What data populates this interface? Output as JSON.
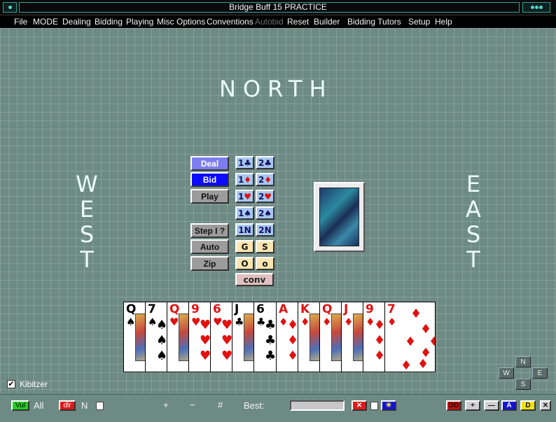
{
  "window": {
    "title": "Bridge Buff 15 PRACTICE"
  },
  "menu": [
    {
      "label": "File",
      "enabled": true
    },
    {
      "label": "MODE",
      "enabled": true
    },
    {
      "label": "Dealing",
      "enabled": true
    },
    {
      "label": "Bidding",
      "enabled": true
    },
    {
      "label": "Playing",
      "enabled": true
    },
    {
      "label": "Misc Options",
      "enabled": true
    },
    {
      "label": "Conventions",
      "enabled": true
    },
    {
      "label": "Autobid",
      "enabled": false
    },
    {
      "label": "Reset",
      "enabled": true
    },
    {
      "label": "Builder",
      "enabled": true
    },
    {
      "label": "Bidding Tutors",
      "enabled": true
    },
    {
      "label": "Setup",
      "enabled": true
    },
    {
      "label": "Help",
      "enabled": true
    }
  ],
  "seats": {
    "north": "NORTH",
    "west": [
      "W",
      "E",
      "S",
      "T"
    ],
    "east": [
      "E",
      "A",
      "S",
      "T"
    ]
  },
  "controls": {
    "deal": "Deal",
    "bid": "Bid",
    "play": "Play",
    "step": "Step I ?",
    "auto": "Auto",
    "zip": "Zip"
  },
  "bidbox": {
    "rows": [
      [
        {
          "level": "1",
          "suit": "♣",
          "red": false
        },
        {
          "level": "2",
          "suit": "♣",
          "red": false
        }
      ],
      [
        {
          "level": "1",
          "suit": "♦",
          "red": true
        },
        {
          "level": "2",
          "suit": "♦",
          "red": true
        }
      ],
      [
        {
          "level": "1",
          "suit": "♥",
          "red": true
        },
        {
          "level": "2",
          "suit": "♥",
          "red": true
        }
      ],
      [
        {
          "level": "1",
          "suit": "♠",
          "red": false
        },
        {
          "level": "2",
          "suit": "♠",
          "red": false
        }
      ],
      [
        {
          "level": "1",
          "suit": "N",
          "red": false
        },
        {
          "level": "2",
          "suit": "N",
          "red": false
        }
      ]
    ],
    "g": "G",
    "s": "S",
    "o1": "O",
    "o2": "o",
    "conv": "conv"
  },
  "hand": [
    {
      "rank": "Q",
      "suit": "♠",
      "red": false,
      "face": true
    },
    {
      "rank": "7",
      "suit": "♠",
      "red": false,
      "face": false
    },
    {
      "rank": "Q",
      "suit": "♥",
      "red": true,
      "face": true
    },
    {
      "rank": "9",
      "suit": "♥",
      "red": true,
      "face": false
    },
    {
      "rank": "6",
      "suit": "♥",
      "red": true,
      "face": false
    },
    {
      "rank": "J",
      "suit": "♣",
      "red": false,
      "face": true
    },
    {
      "rank": "6",
      "suit": "♣",
      "red": false,
      "face": false
    },
    {
      "rank": "A",
      "suit": "♦",
      "red": true,
      "face": false
    },
    {
      "rank": "K",
      "suit": "♦",
      "red": true,
      "face": true
    },
    {
      "rank": "Q",
      "suit": "♦",
      "red": true,
      "face": true
    },
    {
      "rank": "J",
      "suit": "♦",
      "red": true,
      "face": true
    },
    {
      "rank": "9",
      "suit": "♦",
      "red": true,
      "face": false
    },
    {
      "rank": "7",
      "suit": "♦",
      "red": true,
      "face": false
    }
  ],
  "compass": {
    "n": "N",
    "w": "W",
    "e": "E",
    "s": "S"
  },
  "kibitzer": {
    "label": "Kibitzer",
    "checked": true,
    "mark": "✔"
  },
  "status": {
    "vul_tag": "Vul",
    "vul_value": "All",
    "dlr_tag": "dlr",
    "dlr_value": "N",
    "plus": "+",
    "minus": "−",
    "hash": "#",
    "best_label": "Best:",
    "close_icon": "✕",
    "sun_icon": "☀",
    "dd": "DD",
    "btn_plus": "+",
    "btn_minus": "—",
    "btn_a": "A",
    "btn_d": "D",
    "tiny_x": "✕"
  },
  "colors": {
    "felt": "#6e8a84",
    "deal": "#7d7df0",
    "bid": "#0b0bff",
    "vul": "#1fd01f",
    "dlr": "#e01818"
  }
}
